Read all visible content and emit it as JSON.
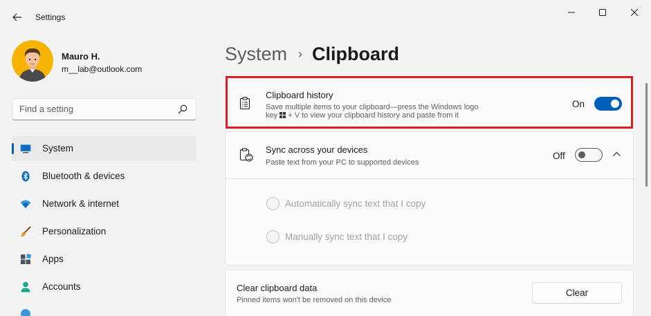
{
  "window": {
    "app_title": "Settings",
    "controls": {
      "minimize": "minimize",
      "maximize": "maximize",
      "close": "close"
    }
  },
  "profile": {
    "name": "Mauro H.",
    "email": "m__lab@outlook.com"
  },
  "search": {
    "placeholder": "Find a setting"
  },
  "sidebar": {
    "items": [
      {
        "label": "System",
        "icon": "monitor-icon",
        "selected": true
      },
      {
        "label": "Bluetooth & devices",
        "icon": "bluetooth-icon",
        "selected": false
      },
      {
        "label": "Network & internet",
        "icon": "wifi-icon",
        "selected": false
      },
      {
        "label": "Personalization",
        "icon": "brush-icon",
        "selected": false
      },
      {
        "label": "Apps",
        "icon": "apps-icon",
        "selected": false
      },
      {
        "label": "Accounts",
        "icon": "person-icon",
        "selected": false
      }
    ]
  },
  "breadcrumb": {
    "parent": "System",
    "separator": "›",
    "current": "Clipboard"
  },
  "clipboard_history": {
    "title": "Clipboard history",
    "desc_line1": "Save multiple items to your clipboard—press the Windows logo",
    "desc_line2_prefix": "key",
    "desc_line2_suffix": "+ V to view your clipboard history and paste from it",
    "toggle_state": "On",
    "enabled": true
  },
  "sync": {
    "title": "Sync across your devices",
    "desc": "Paste text from your PC to supported devices",
    "toggle_state": "Off",
    "enabled": false,
    "options": [
      {
        "label": "Automatically sync text that I copy"
      },
      {
        "label": "Manually sync text that I copy"
      }
    ]
  },
  "clear": {
    "title": "Clear clipboard data",
    "desc": "Pinned items won't be removed on this device",
    "button_label": "Clear"
  },
  "colors": {
    "accent": "#005fb8",
    "highlight": "#e11b22",
    "background": "#f3f3f3",
    "card": "#fbfbfb"
  }
}
